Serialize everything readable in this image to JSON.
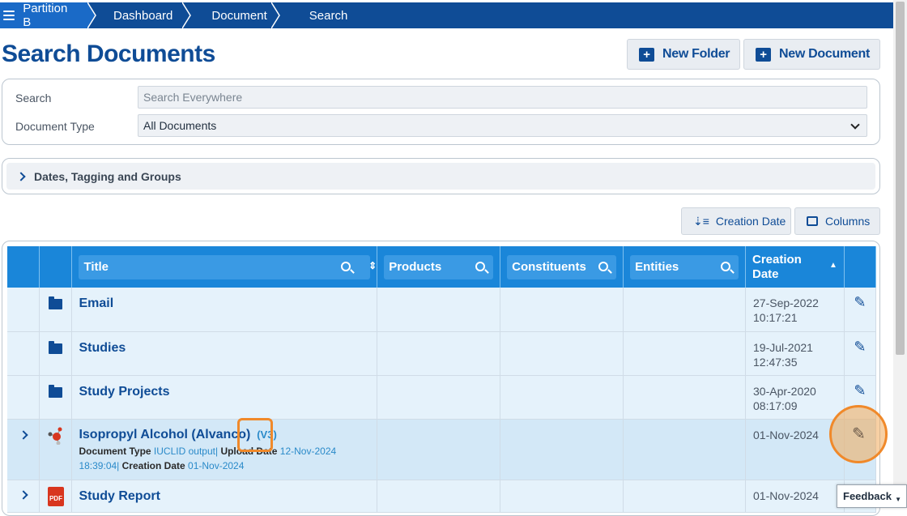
{
  "breadcrumb": [
    "Partition B",
    "Dashboard",
    "Document",
    "Search"
  ],
  "page_title": "Search Documents",
  "buttons": {
    "new_folder": "New Folder",
    "new_document": "New Document",
    "sort": "Creation Date",
    "columns": "Columns"
  },
  "search": {
    "search_label": "Search",
    "search_placeholder": "Search Everywhere",
    "doctype_label": "Document Type",
    "doctype_value": "All Documents"
  },
  "filters": {
    "label": "Dates, Tagging and Groups"
  },
  "table": {
    "headers": {
      "title": "Title",
      "products": "Products",
      "constituents": "Constituents",
      "entities": "Entities",
      "creation_date": "Creation Date"
    },
    "rows": [
      {
        "title": "Email",
        "date": "27-Sep-2022",
        "time": "10:17:21"
      },
      {
        "title": "Studies",
        "date": "19-Jul-2021",
        "time": "12:47:35"
      },
      {
        "title": "Study Projects",
        "date": "30-Apr-2020",
        "time": "08:17:09"
      },
      {
        "title": "Isopropyl Alcohol (Alvanco)",
        "version": "(V3)",
        "date": "01-Nov-2024",
        "meta": {
          "doctype_label": "Document Type",
          "doctype": "IUCLID output",
          "upload_label": "Upload Date",
          "upload": "12-Nov-2024",
          "upload_time": "18:39:04",
          "creation_label": "Creation Date",
          "creation": "01-Nov-2024"
        }
      },
      {
        "title": "Study Report",
        "date": "01-Nov-2024"
      }
    ]
  },
  "feedback": "Feedback",
  "colors": {
    "primary": "#0f4c96",
    "header": "#1a86d9",
    "highlight": "#f0892a"
  }
}
